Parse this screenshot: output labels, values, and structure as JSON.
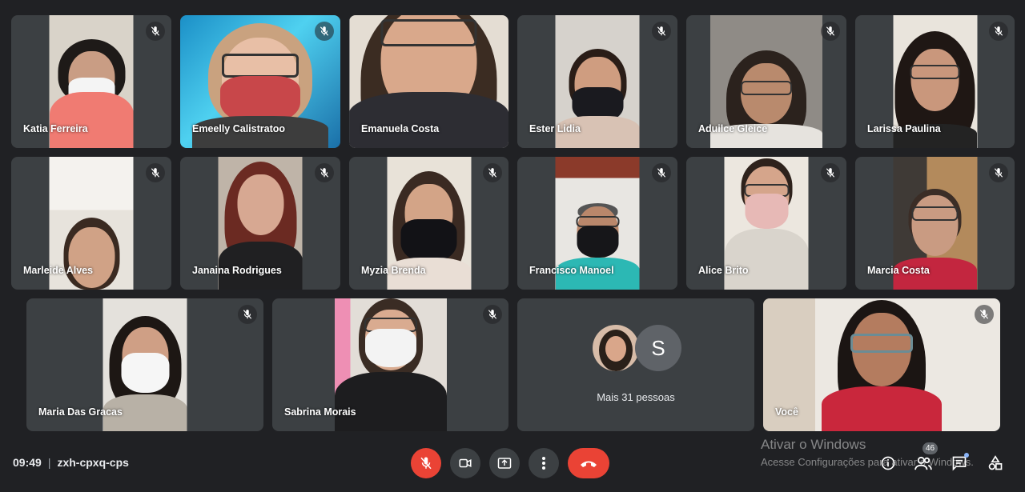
{
  "participants": [
    {
      "name": "Katia Ferreira"
    },
    {
      "name": "Emeelly Calistratoo"
    },
    {
      "name": "Emanuela Costa"
    },
    {
      "name": "Ester Lidia"
    },
    {
      "name": "Aduilce Gleice"
    },
    {
      "name": "Larissa Paulina"
    },
    {
      "name": "Marleide Alves"
    },
    {
      "name": "Janaina Rodrigues"
    },
    {
      "name": "Myzia Brenda"
    },
    {
      "name": "Francisco Manoel"
    },
    {
      "name": "Alice Brito"
    },
    {
      "name": "Marcia Costa"
    },
    {
      "name": "Maria Das Gracas"
    },
    {
      "name": "Sabrina Morais"
    },
    {
      "name": "Você"
    }
  ],
  "others": {
    "label": "Mais 31 pessoas",
    "avatar_letter": "S"
  },
  "meeting": {
    "time": "09:49",
    "separator": "|",
    "code": "zxh-cpxq-cps"
  },
  "people_count": "46",
  "watermark": {
    "line1": "Ativar o Windows",
    "line2": "Acesse Configurações para ativar o Windows."
  },
  "colors": {
    "end_call": "#ea4335",
    "mic_off": "#ea4335",
    "tile_bg": "#3c4043",
    "page_bg": "#202124"
  },
  "icons": {
    "mic_off": "mic-off-icon",
    "camera": "camera-icon",
    "present": "present-screen-icon",
    "more": "more-options-icon",
    "end_call": "end-call-icon",
    "info": "info-icon",
    "people": "people-icon",
    "chat": "chat-icon",
    "activities": "activities-icon"
  }
}
